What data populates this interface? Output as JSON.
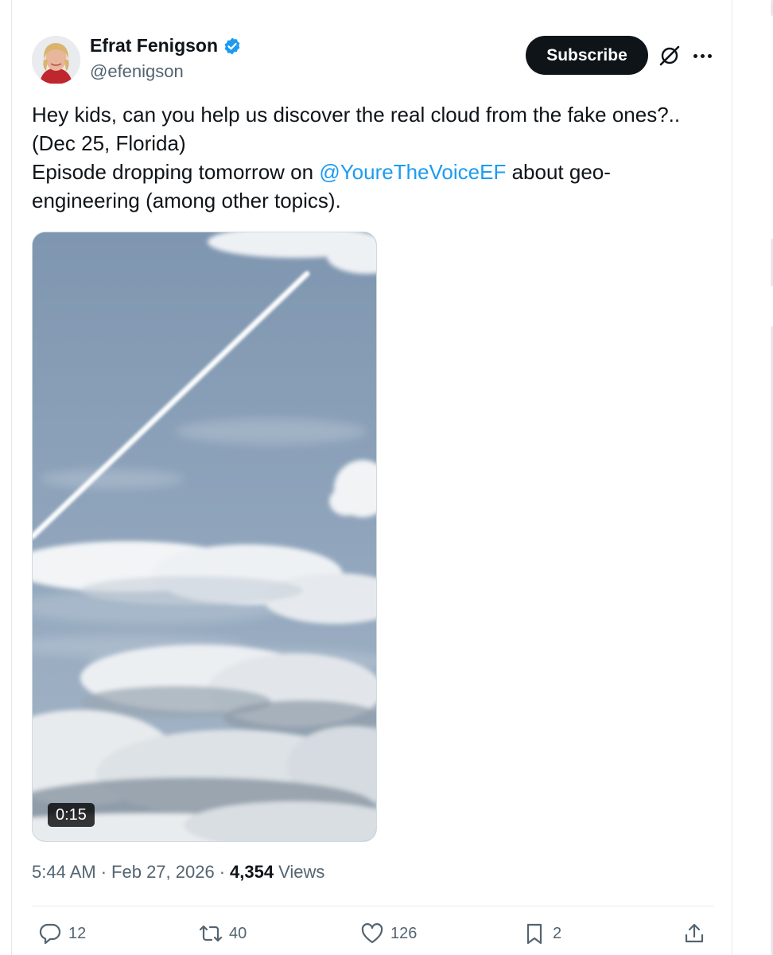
{
  "tweet": {
    "author_name": "Efrat Fenigson",
    "handle": "@efenigson",
    "subscribe_label": "Subscribe",
    "text_line1": "Hey kids, can you help us discover the real cloud from the fake ones?..",
    "text_line2": "(Dec 25, Florida)",
    "text_line3_pre": "Episode dropping tomorrow on ",
    "mention": "@YoureTheVoiceEF",
    "text_line3_post": " about geo-",
    "text_line4": "engineering (among other topics).",
    "video_duration": "0:15",
    "time": "5:44 AM",
    "separator": "·",
    "date": "Feb 27, 2026",
    "views_count": "4,354",
    "views_label": "Views"
  },
  "actions": {
    "replies": "12",
    "reposts": "40",
    "likes": "126",
    "bookmarks": "2"
  },
  "icons": [
    "verified-badge-icon",
    "grok-icon",
    "more-icon",
    "reply-icon",
    "repost-icon",
    "like-icon",
    "bookmark-icon",
    "share-icon"
  ],
  "colors": {
    "accent": "#1d9bf0",
    "text": "#0f1419",
    "secondary": "#536471",
    "button_bg": "#0f1419"
  }
}
